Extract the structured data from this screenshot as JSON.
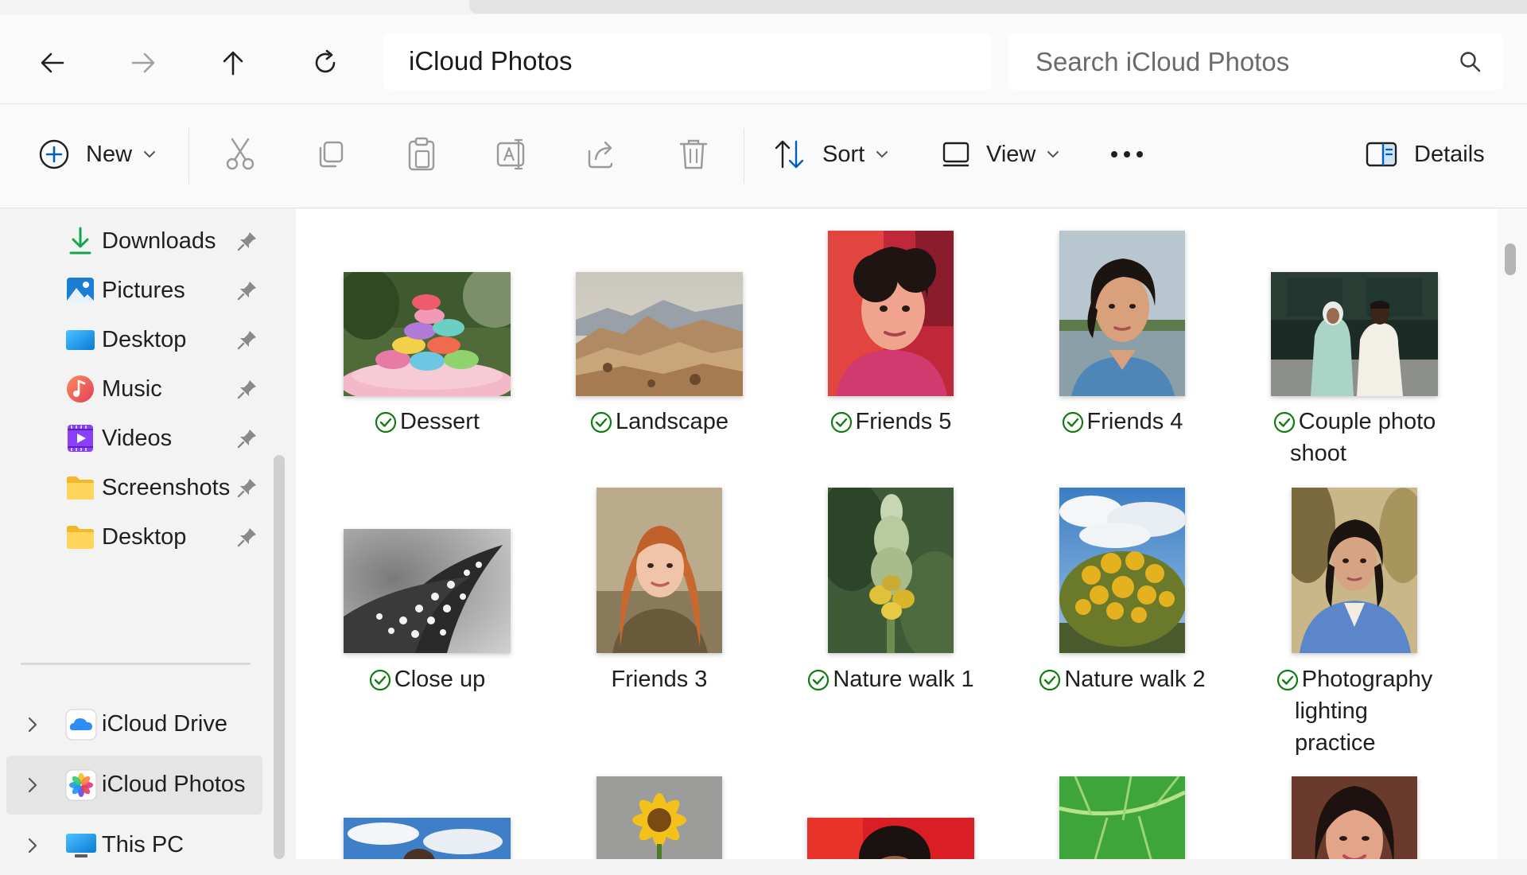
{
  "window": {
    "title": "iCloud Photos"
  },
  "nav": {
    "back": "back",
    "forward": "forward",
    "up": "up",
    "refresh": "refresh",
    "address": "iCloud Photos",
    "search_placeholder": "Search iCloud Photos"
  },
  "toolbar": {
    "new_label": "New",
    "sort_label": "Sort",
    "view_label": "View",
    "details_label": "Details"
  },
  "sidebar": {
    "quick": [
      {
        "label": "Downloads",
        "icon": "download-icon"
      },
      {
        "label": "Pictures",
        "icon": "pictures-icon"
      },
      {
        "label": "Desktop",
        "icon": "desktop-icon"
      },
      {
        "label": "Music",
        "icon": "music-icon"
      },
      {
        "label": "Videos",
        "icon": "videos-icon"
      },
      {
        "label": "Screenshots",
        "icon": "folder-icon"
      },
      {
        "label": "Desktop",
        "icon": "folder-icon"
      }
    ],
    "tree": [
      {
        "label": "iCloud Drive",
        "icon": "icloud-drive-icon"
      },
      {
        "label": "iCloud Photos",
        "icon": "icloud-photos-icon",
        "selected": true
      },
      {
        "label": "This PC",
        "icon": "this-pc-icon"
      }
    ]
  },
  "photos": [
    {
      "name": "Dessert",
      "synced": true
    },
    {
      "name": "Landscape",
      "synced": true
    },
    {
      "name": "Friends 5",
      "synced": true
    },
    {
      "name": "Friends 4",
      "synced": true
    },
    {
      "name": "Couple photo shoot",
      "line1": "Couple photo",
      "line2": "shoot",
      "synced": true
    },
    {
      "name": "Close up",
      "synced": true
    },
    {
      "name": "Friends 3",
      "synced": false
    },
    {
      "name": "Nature walk 1",
      "synced": true
    },
    {
      "name": "Nature walk 2",
      "synced": true
    },
    {
      "name": "Photography lighting practice",
      "line1": "Photography",
      "line2": "lighting",
      "line3": "practice",
      "synced": true
    }
  ],
  "colors": {
    "accent": "#005fb8",
    "sync_green": "#107c10",
    "selected_bg": "#e5e5e5"
  }
}
